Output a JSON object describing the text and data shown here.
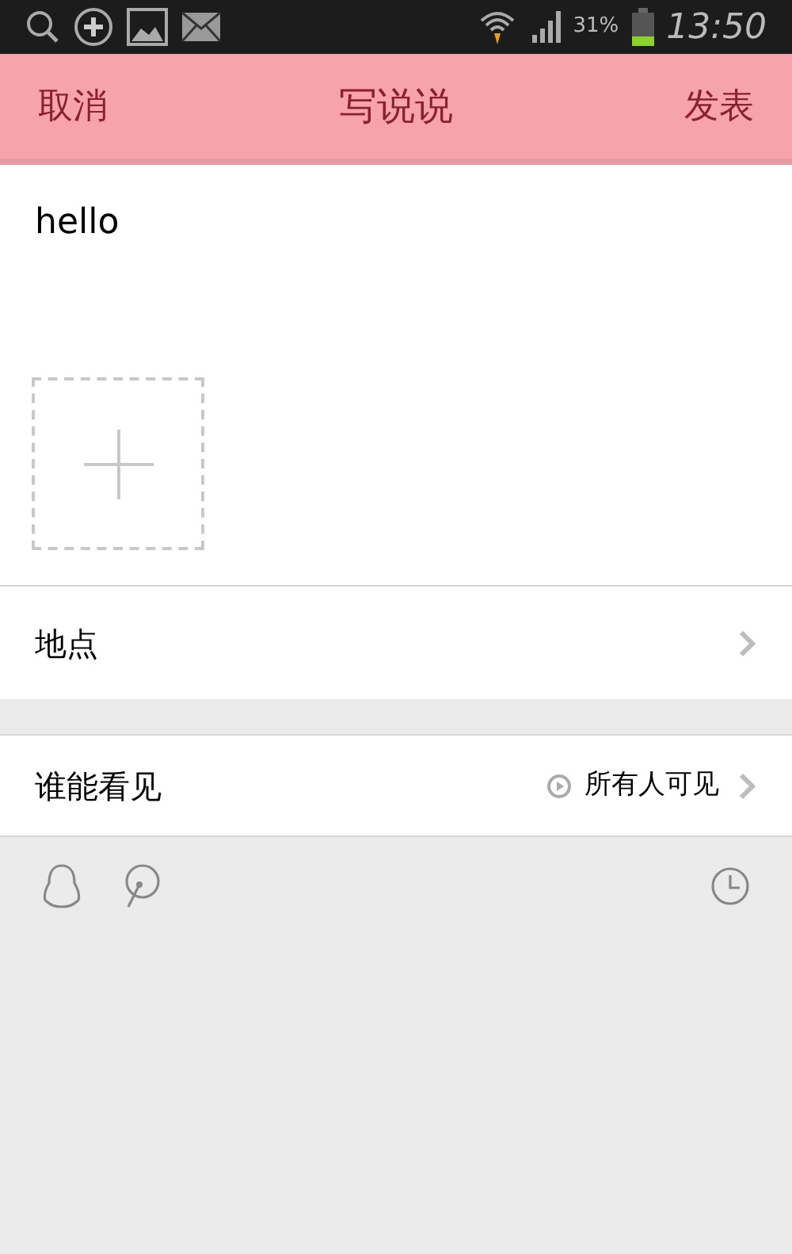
{
  "status_bar": {
    "battery_text": "31%",
    "time": "13:50"
  },
  "header": {
    "cancel": "取消",
    "title": "写说说",
    "publish": "发表"
  },
  "post": {
    "text": "hello"
  },
  "location": {
    "label": "地点"
  },
  "visibility": {
    "label": "谁能看见",
    "value": "所有人可见"
  }
}
